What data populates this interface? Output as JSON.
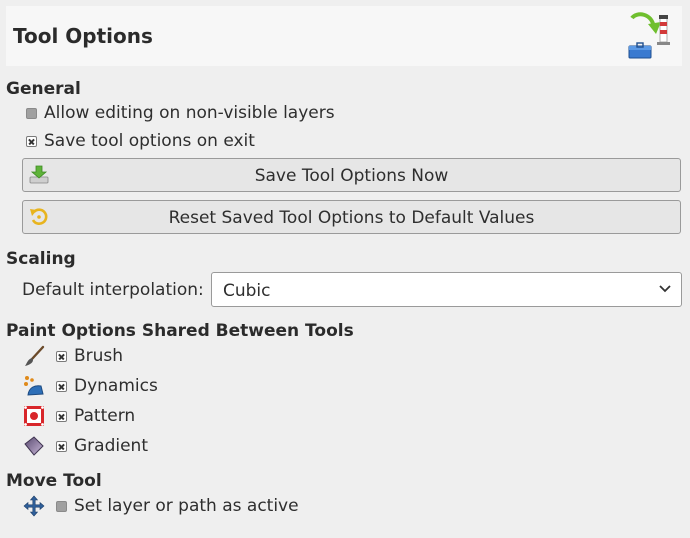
{
  "header": {
    "title": "Tool Options",
    "icon": "restore-to-default-icon"
  },
  "general": {
    "title": "General",
    "allow_editing": {
      "label": "Allow editing on non-visible layers",
      "checked": false
    },
    "save_on_exit": {
      "label": "Save tool options on exit",
      "checked": true
    },
    "save_now_button": {
      "label": "Save Tool Options Now",
      "icon": "save-download-icon"
    },
    "reset_button": {
      "label": "Reset Saved Tool Options to Default Values",
      "icon": "reset-icon"
    }
  },
  "scaling": {
    "title": "Scaling",
    "interpolation_label": "Default interpolation:",
    "interpolation_value": "Cubic"
  },
  "paint_options": {
    "title": "Paint Options Shared Between Tools",
    "items": [
      {
        "label": "Brush",
        "checked": true,
        "icon": "brush-icon"
      },
      {
        "label": "Dynamics",
        "checked": true,
        "icon": "dynamics-icon"
      },
      {
        "label": "Pattern",
        "checked": true,
        "icon": "pattern-icon"
      },
      {
        "label": "Gradient",
        "checked": true,
        "icon": "gradient-icon"
      }
    ]
  },
  "move_tool": {
    "title": "Move Tool",
    "set_active": {
      "label": "Set layer or path as active",
      "checked": false,
      "icon": "move-icon"
    }
  }
}
